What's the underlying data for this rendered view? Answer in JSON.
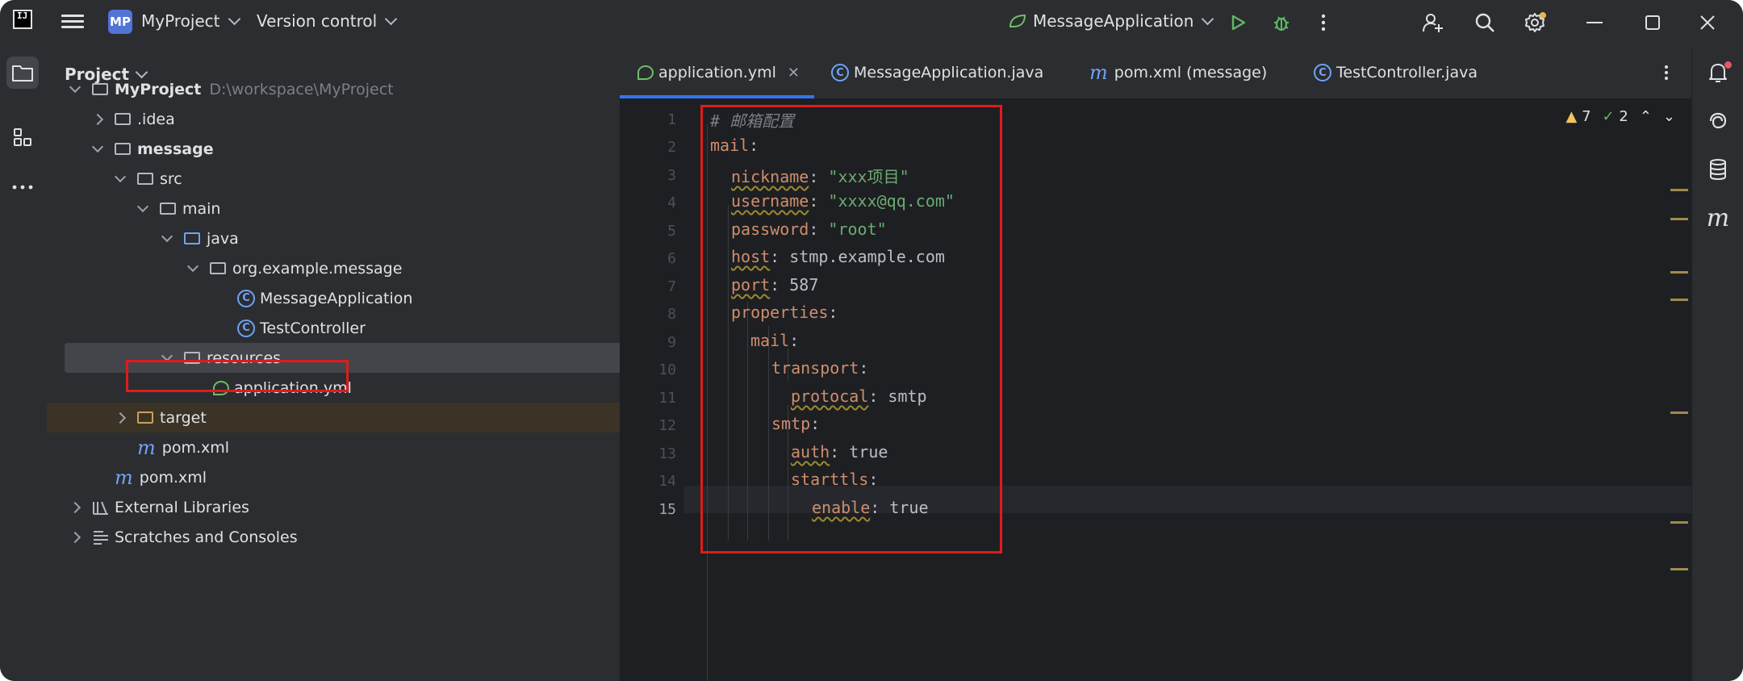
{
  "titlebar": {
    "logo": "IJ",
    "project_badge": "MP",
    "project_name": "MyProject",
    "vcs_label": "Version control",
    "run_config": "MessageApplication"
  },
  "project_panel": {
    "title": "Project",
    "tree": [
      {
        "label": "MyProject",
        "hint": "D:\\workspace\\MyProject"
      },
      {
        "label": ".idea"
      },
      {
        "label": "message"
      },
      {
        "label": "src"
      },
      {
        "label": "main"
      },
      {
        "label": "java"
      },
      {
        "label": "org.example.message"
      },
      {
        "label": "MessageApplication"
      },
      {
        "label": "TestController"
      },
      {
        "label": "resources"
      },
      {
        "label": "application.yml"
      },
      {
        "label": "target"
      },
      {
        "label": "pom.xml"
      },
      {
        "label": "pom.xml"
      },
      {
        "label": "External Libraries"
      },
      {
        "label": "Scratches and Consoles"
      }
    ]
  },
  "editor": {
    "tabs": [
      {
        "label": "application.yml",
        "active": true
      },
      {
        "label": "MessageApplication.java"
      },
      {
        "label": "pom.xml (message)"
      },
      {
        "label": "TestController.java"
      }
    ],
    "warnings": "7",
    "weak_warnings": "2",
    "line_numbers": [
      "1",
      "2",
      "3",
      "4",
      "5",
      "6",
      "7",
      "8",
      "9",
      "10",
      "11",
      "12",
      "13",
      "14",
      "15"
    ],
    "code": {
      "l1_comment": "# 邮箱配置",
      "l2_key": "mail",
      "l3_key": "nickname",
      "l3_val": "\"xxx项目\"",
      "l4_key": "username",
      "l4_val": "\"xxxx@qq.com\"",
      "l5_key": "password",
      "l5_val": "\"root\"",
      "l6_key": "host",
      "l6_val": "stmp.example.com",
      "l7_key": "port",
      "l7_val": "587",
      "l8_key": "properties",
      "l9_key": "mail",
      "l10_key": "transport",
      "l11_key": "protocal",
      "l11_val": "smtp",
      "l12_key": "smtp",
      "l13_key": "auth",
      "l13_val": "true",
      "l14_key": "starttls",
      "l15_key": "enable",
      "l15_val": "true"
    }
  },
  "colors": {
    "accent": "#3574f0",
    "highlight_box": "#e01b1b",
    "yaml_key": "#cf8e6d",
    "yaml_string": "#6aab73"
  }
}
